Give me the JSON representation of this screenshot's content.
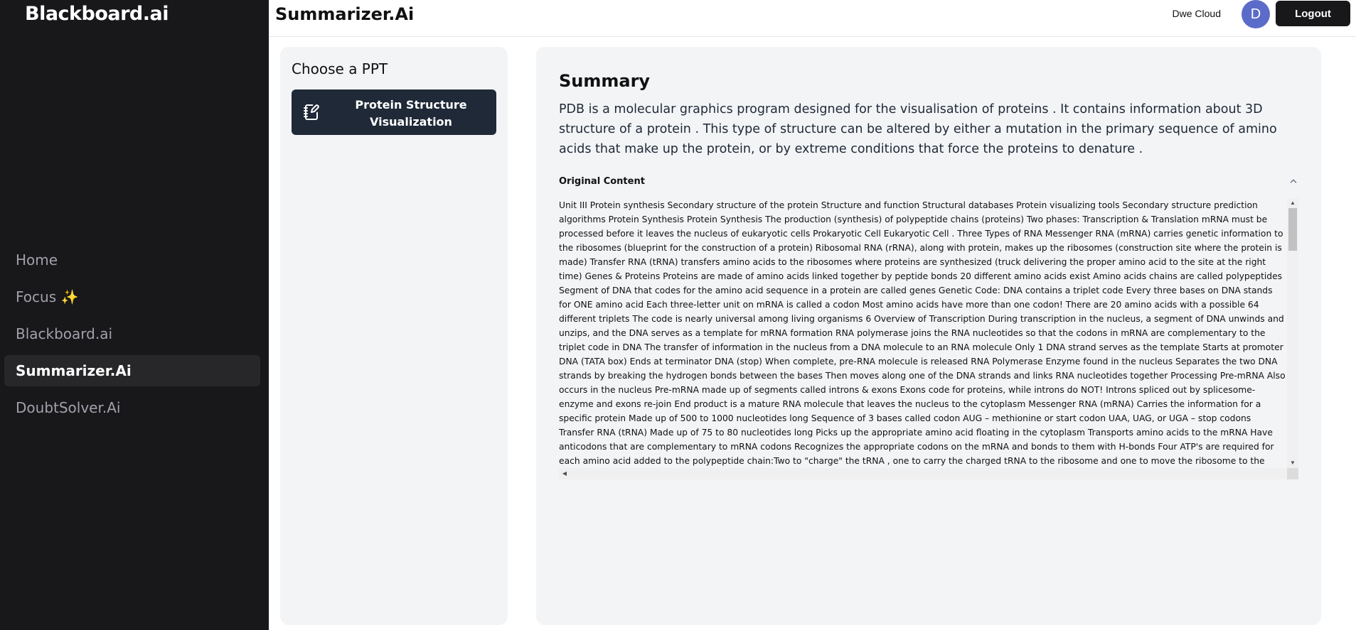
{
  "sidebar": {
    "brand": "Blackboard.ai",
    "items": [
      {
        "label": "Home",
        "active": false
      },
      {
        "label": "Focus ✨",
        "active": false
      },
      {
        "label": "Blackboard.ai",
        "active": false
      },
      {
        "label": "Summarizer.Ai",
        "active": true
      },
      {
        "label": "DoubtSolver.Ai",
        "active": false
      }
    ]
  },
  "header": {
    "title": "Summarizer.Ai",
    "user_name": "Dwe Cloud",
    "avatar_initial": "D",
    "logout_label": "Logout"
  },
  "ppt_panel": {
    "heading": "Choose a PPT",
    "items": [
      {
        "label": "Protein Structure Visualization",
        "icon": "notebook-pen-icon"
      }
    ]
  },
  "summary": {
    "title": "Summary",
    "text": "PDB is a molecular graphics program designed for the visualisation of proteins . It contains information about 3D structure of a protein . This type of structure can be altered by either a mutation in the primary sequence of amino acids that make up the protein, or by extreme conditions that force the proteins to denature .",
    "original_label": "Original Content",
    "original_text": "Unit III Protein synthesis Secondary structure of the protein Structure and function Structural databases Protein visualizing tools Secondary structure prediction algorithms Protein Synthesis Protein Synthesis The production (synthesis) of polypeptide chains (proteins) Two phases: Transcription & Translation mRNA must be processed before it leaves the nucleus of eukaryotic cells Prokaryotic Cell Eukaryotic Cell . Three Types of RNA Messenger RNA (mRNA) carries genetic information to the ribosomes (blueprint for the construction of a protein) Ribosomal RNA (rRNA), along with protein, makes up the ribosomes (construction site where the protein is made) Transfer RNA (tRNA) transfers amino acids to the ribosomes where proteins are synthesized (truck delivering the proper amino acid to the site at the right time) Genes & Proteins Proteins are made of amino acids linked together by peptide bonds 20 different amino acids exist Amino acids chains are called polypeptides Segment of DNA that codes for the amino acid sequence in a protein are called genes Genetic Code: DNA contains a triplet code Every three bases on DNA stands for ONE amino acid Each three-letter unit on mRNA is called a codon Most amino acids have more than one codon! There are 20 amino acids with a possible 64 different triplets The code is nearly universal among living organisms 6 Overview of Transcription During transcription in the nucleus, a segment of DNA unwinds and unzips, and the DNA serves as a template for mRNA formation RNA polymerase joins the RNA nucleotides so that the codons in mRNA are complementary to the triplet code in DNA The transfer of information in the nucleus from a DNA molecule to an RNA molecule Only 1 DNA strand serves as the template Starts at promoter DNA (TATA box) Ends at terminator DNA (stop) When complete, pre-RNA molecule is released RNA Polymerase Enzyme found in the nucleus Separates the two DNA strands by breaking the hydrogen bonds between the bases Then moves along one of the DNA strands and links RNA nucleotides together Processing Pre-mRNA Also occurs in the nucleus Pre-mRNA made up of segments called introns & exons Exons code for proteins, while introns do NOT! Introns spliced out by splicesome-enzyme and exons re-join End product is a mature RNA molecule that leaves the nucleus to the cytoplasm Messenger RNA (mRNA) Carries the information for a specific protein Made up of 500 to 1000 nucleotides long Sequence of 3 bases called codon AUG – methionine or start codon UAA, UAG, or UGA – stop codons Transfer RNA (tRNA) Made up of 75 to 80 nucleotides long Picks up the appropriate amino acid floating in the cytoplasm Transports amino acids to the mRNA Have anticodons that are complementary to mRNA codons Recognizes the appropriate codons on the mRNA and bonds to them with H-bonds Four ATP's are required for each amino acid added to the polypeptide chain:Two to \"charge\" the tRNA , one to carry the charged tRNA to the ribosome and one to move the ribosome to the"
  },
  "colors": {
    "sidebar_bg": "#18181b",
    "active_nav_bg": "#27272a",
    "panel_bg": "#f3f4f6",
    "ppt_card_bg": "#1f2937",
    "avatar_bg": "#5b6bc9"
  }
}
